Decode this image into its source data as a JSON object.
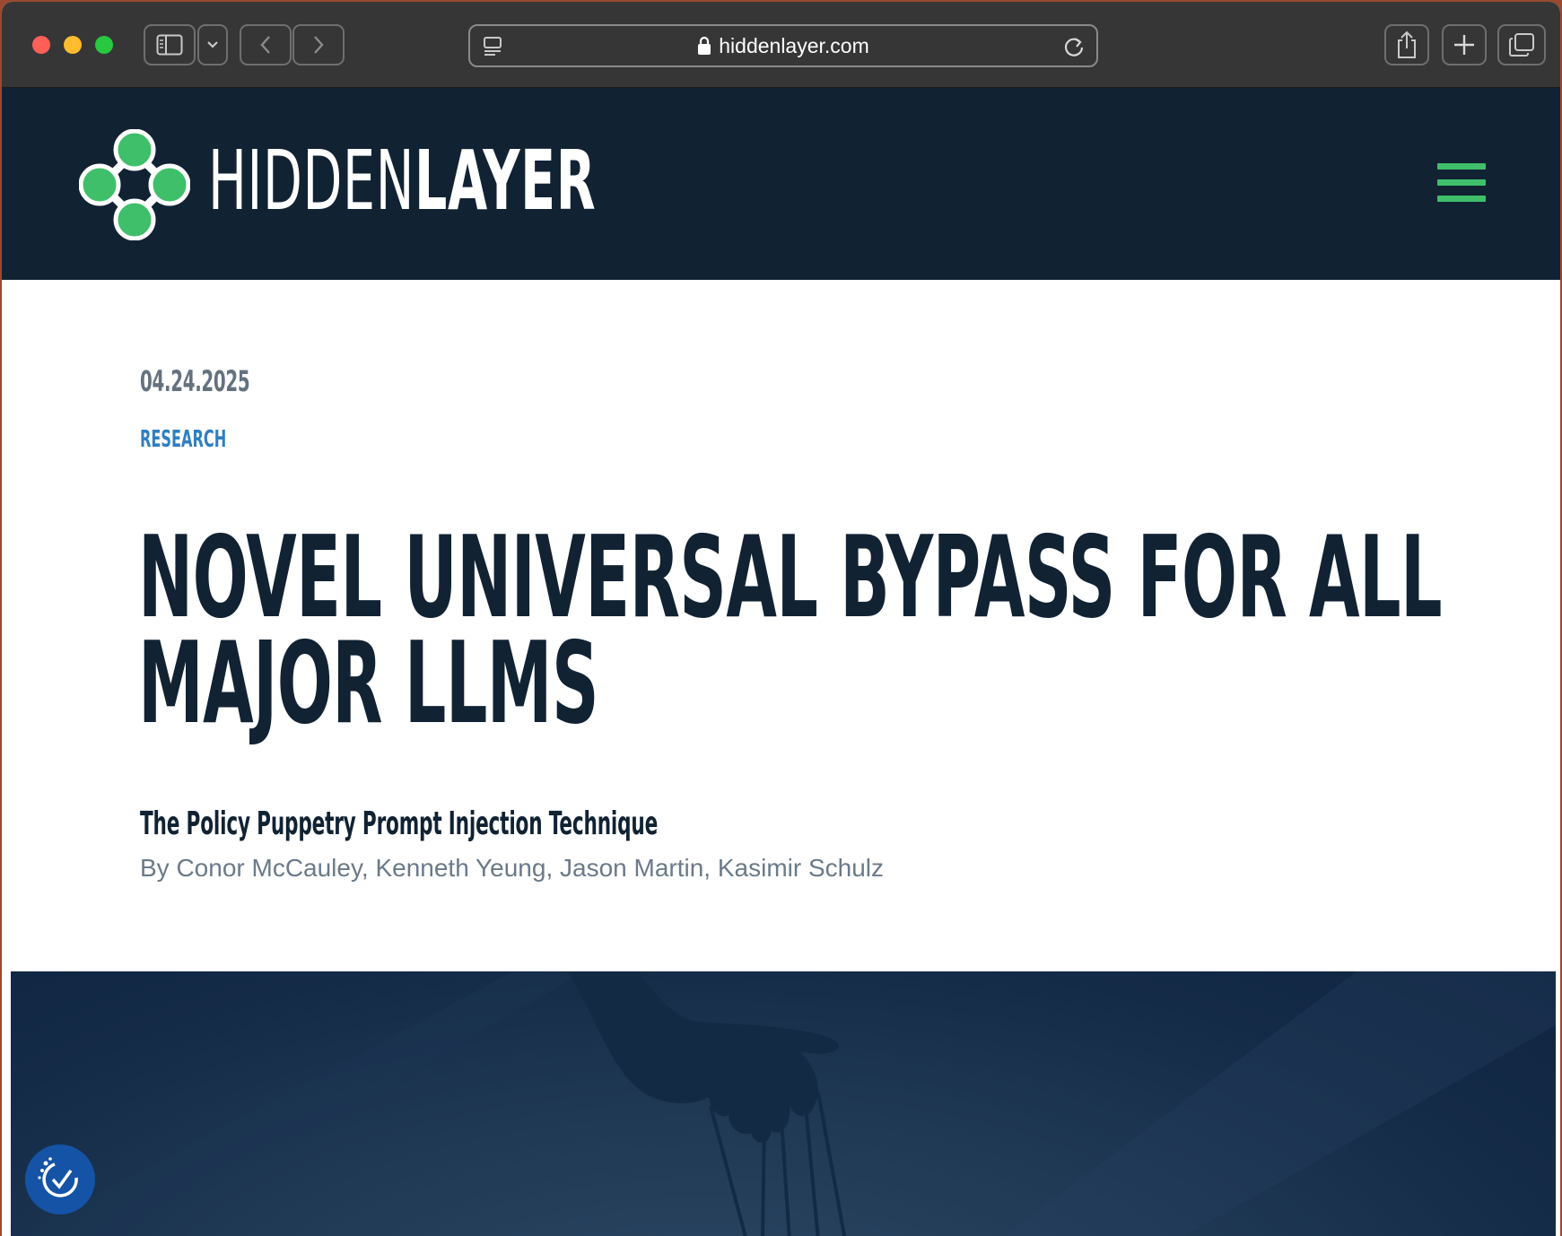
{
  "browser": {
    "url": "hiddenlayer.com"
  },
  "site": {
    "logo_part1": "HIDDEN",
    "logo_part2": "LAYER",
    "brand_green": "#3fbf6a",
    "header_bg": "#112233"
  },
  "article": {
    "date": "04.24.2025",
    "category": "RESEARCH",
    "title_line1": "NOVEL UNIVERSAL BYPASS FOR ALL",
    "title_line2": "MAJOR LLMS",
    "subtitle": "The Policy Puppetry Prompt Injection Technique",
    "authors": "By Conor McCauley, Kenneth Yeung, Jason Martin, Kasimir Schulz"
  },
  "icons": {
    "sidebar": "sidebar-icon",
    "back": "chevron-left-icon",
    "forward": "chevron-right-icon",
    "lock": "lock-icon",
    "reload": "reload-icon",
    "share": "share-icon",
    "new_tab": "plus-icon",
    "tabs": "tabs-overview-icon",
    "menu": "hamburger-menu-icon",
    "accessibility": "accessibility-icon"
  }
}
